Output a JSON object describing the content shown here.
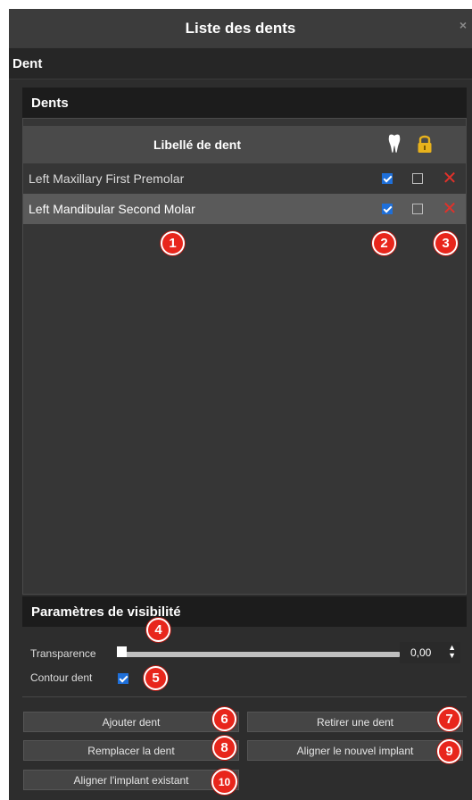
{
  "window": {
    "title": "Liste des dents",
    "close": "×"
  },
  "section": {
    "title": "Dent"
  },
  "teeth_group": {
    "title": "Dents"
  },
  "table": {
    "header_label": "Libellé de dent",
    "rows": [
      {
        "label": "Left Maxillary First Premolar",
        "visible": true,
        "locked": false,
        "delete": "✕"
      },
      {
        "label": "Left Mandibular Second Molar",
        "visible": true,
        "locked": false,
        "delete": "✕",
        "selected": true
      }
    ]
  },
  "visibility": {
    "title": "Paramètres de visibilité",
    "transparence_label": "Transparence",
    "transparence_value": "0,00",
    "transparence_level": 0.0,
    "contour_label": "Contour dent",
    "contour_checked": true
  },
  "buttons": {
    "add": "Ajouter dent",
    "remove": "Retirer une dent",
    "replace": "Remplacer la dent",
    "align_new": "Aligner le nouvel implant",
    "align_existing": "Aligner l'implant existant"
  },
  "badges": [
    "1",
    "2",
    "3",
    "4",
    "5",
    "6",
    "7",
    "8",
    "9",
    "10"
  ],
  "colors": {
    "accent": "#1e6fd9",
    "delete": "#e2312a",
    "badge": "#e8261c",
    "lock": "#e8b21c"
  },
  "icons": {
    "tooth": "tooth-icon",
    "lock": "lock-icon",
    "delete": "delete-x-icon"
  }
}
